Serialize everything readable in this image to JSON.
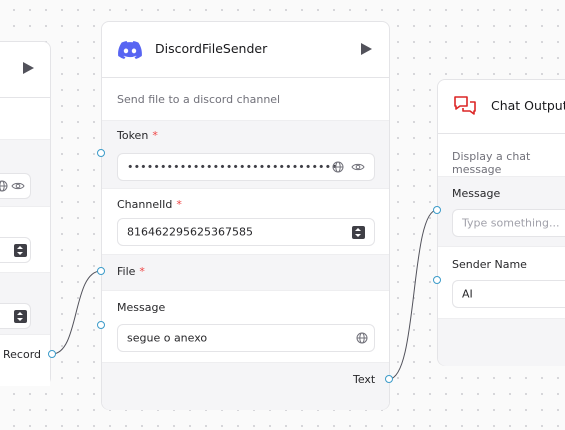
{
  "left_node": {
    "output_label": "Record"
  },
  "discord_node": {
    "title": "DiscordFileSender",
    "description": "Send file to a discord channel",
    "fields": {
      "token": {
        "label": "Token",
        "required_mark": "*",
        "value": "••••••••••••••••••••••••••••••••"
      },
      "channel_id": {
        "label": "ChannelId",
        "required_mark": "*",
        "value": "816462295625367585"
      },
      "file": {
        "label": "File",
        "required_mark": "*"
      },
      "message": {
        "label": "Message",
        "value": "segue o anexo"
      }
    },
    "output_label": "Text"
  },
  "chat_output_node": {
    "title": "Chat Output",
    "description": "Display a chat message",
    "fields": {
      "message": {
        "label": "Message",
        "placeholder": "Type something..."
      },
      "sender_name": {
        "label": "Sender Name",
        "value": "AI"
      }
    }
  },
  "colors": {
    "handle": "#3b9bc9",
    "discord_brand": "#5865F2",
    "chat_icon": "#dc2626",
    "required": "#ef4444"
  },
  "icons": [
    "play-icon",
    "discord-icon",
    "chat-icon",
    "globe-icon",
    "eye-icon",
    "stepper-icon"
  ]
}
